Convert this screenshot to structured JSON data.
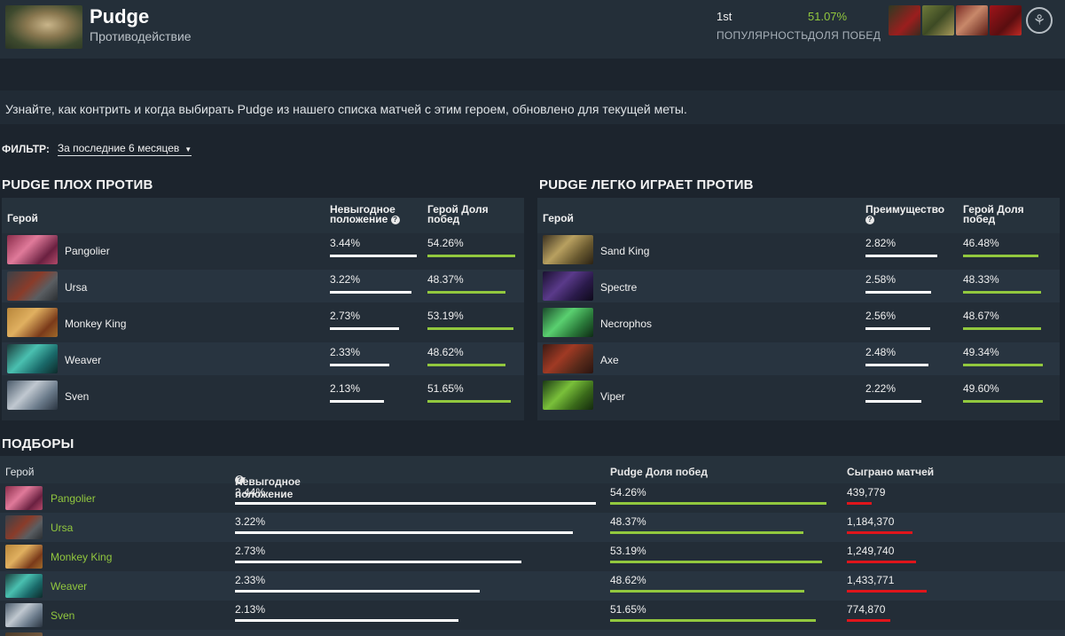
{
  "header": {
    "hero_name": "Pudge",
    "subtitle": "Противодействие",
    "popularity_value": "1st",
    "popularity_label": "ПОПУЛЯРНОСТЬ",
    "winrate_value": "51.07%",
    "winrate_label": "ДОЛЯ ПОБЕД"
  },
  "description": "Узнайте, как контрить и когда выбирать Pudge из нашего списка матчей с этим героем, обновлено для текущей меты.",
  "filter": {
    "label": "ФИЛЬТР:",
    "value": "За последние 6 месяцев"
  },
  "bad_against": {
    "title": "PUDGE ПЛОХ ПРОТИВ",
    "col_hero": "Герой",
    "col_metric": "Невыгодное положение",
    "col_winrate": "Герой Доля побед",
    "rows": [
      {
        "hero": "Pangolier",
        "metric": "3.44%",
        "winrate": "54.26%"
      },
      {
        "hero": "Ursa",
        "metric": "3.22%",
        "winrate": "48.37%"
      },
      {
        "hero": "Monkey King",
        "metric": "2.73%",
        "winrate": "53.19%"
      },
      {
        "hero": "Weaver",
        "metric": "2.33%",
        "winrate": "48.62%"
      },
      {
        "hero": "Sven",
        "metric": "2.13%",
        "winrate": "51.65%"
      }
    ]
  },
  "good_against": {
    "title": "PUDGE ЛЕГКО ИГРАЕТ ПРОТИВ",
    "col_hero": "Герой",
    "col_metric": "Преимущество",
    "col_winrate": "Герой Доля побед",
    "rows": [
      {
        "hero": "Sand King",
        "metric": "2.82%",
        "winrate": "46.48%"
      },
      {
        "hero": "Spectre",
        "metric": "2.58%",
        "winrate": "48.33%"
      },
      {
        "hero": "Necrophos",
        "metric": "2.56%",
        "winrate": "48.67%"
      },
      {
        "hero": "Axe",
        "metric": "2.48%",
        "winrate": "49.34%"
      },
      {
        "hero": "Viper",
        "metric": "2.22%",
        "winrate": "49.60%"
      }
    ]
  },
  "matchups": {
    "title": "ПОДБОРЫ",
    "col_hero": "Герой",
    "col_disadvantage": "Невыгодное положение",
    "col_winrate": "Pudge Доля побед",
    "col_matches": "Сыграно матчей",
    "rows": [
      {
        "hero": "Pangolier",
        "disadvantage": "3.44%",
        "winrate": "54.26%",
        "matches": "439,779"
      },
      {
        "hero": "Ursa",
        "disadvantage": "3.22%",
        "winrate": "48.37%",
        "matches": "1,184,370"
      },
      {
        "hero": "Monkey King",
        "disadvantage": "2.73%",
        "winrate": "53.19%",
        "matches": "1,249,740"
      },
      {
        "hero": "Weaver",
        "disadvantage": "2.33%",
        "winrate": "48.62%",
        "matches": "1,433,771"
      },
      {
        "hero": "Sven",
        "disadvantage": "2.13%",
        "winrate": "51.65%",
        "matches": "774,870"
      }
    ]
  }
}
